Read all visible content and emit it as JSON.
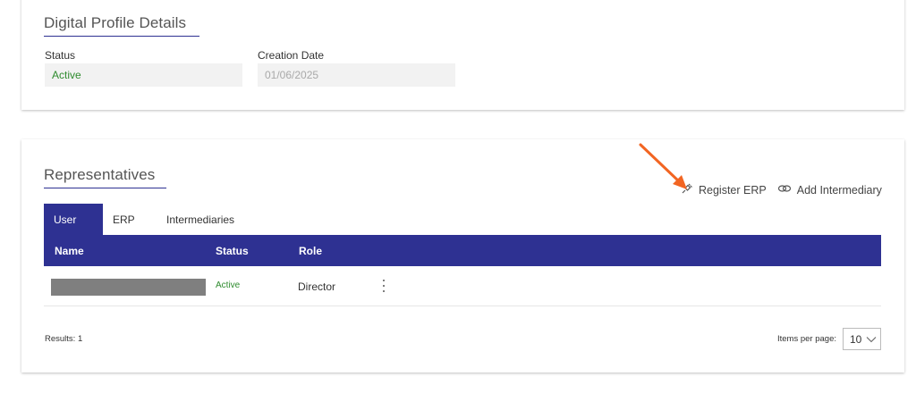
{
  "profile": {
    "title": "Digital Profile Details",
    "status_label": "Status",
    "status_value": "Active",
    "creation_label": "Creation Date",
    "creation_value": "01/06/2025"
  },
  "representatives": {
    "title": "Representatives",
    "actions": {
      "register_erp": "Register ERP",
      "add_intermediary": "Add Intermediary"
    },
    "tabs": [
      "User",
      "ERP",
      "Intermediaries"
    ],
    "columns": [
      "Name",
      "Status",
      "Role"
    ],
    "rows": [
      {
        "name": "",
        "status": "Active",
        "role": "Director"
      }
    ],
    "results": "Results: 1",
    "items_per_page_label": "Items per page:",
    "items_per_page_value": "10"
  },
  "colors": {
    "primary": "#2e3192",
    "active_status": "#2e8b2e",
    "annotation_arrow": "#f26522"
  },
  "icons": {
    "register_erp": "plug-icon",
    "add_intermediary": "link-icon",
    "items_per_page": "chevron-down-icon",
    "row_menu": "kebab-menu-icon"
  }
}
